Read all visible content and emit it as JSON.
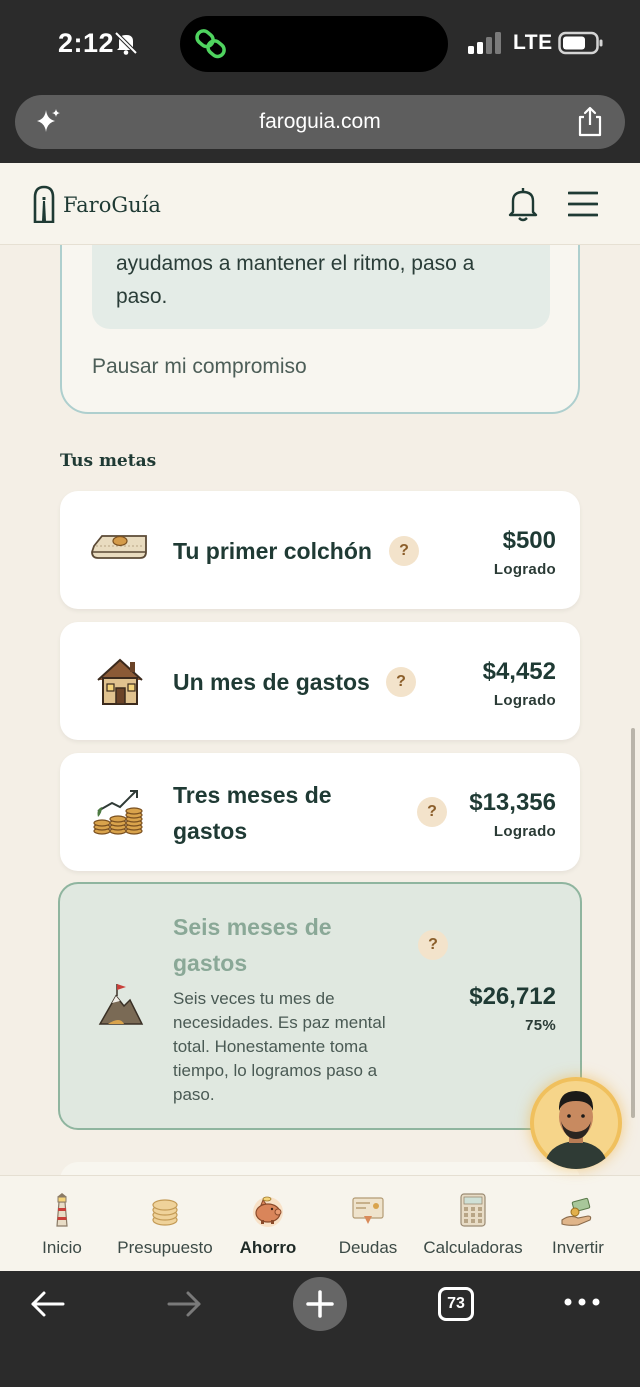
{
  "status_bar": {
    "time": "2:12",
    "network": "LTE"
  },
  "browser": {
    "url": "faroguia.com",
    "tab_count": "73"
  },
  "header": {
    "brand": "FaroGuía"
  },
  "commitment": {
    "note_text": "ayudamos a mantener el ritmo, paso a paso.",
    "pause_label": "Pausar mi compromiso"
  },
  "goals": {
    "title": "Tus metas",
    "items": [
      {
        "name": "Tu primer colchón",
        "amount": "$500",
        "status": "Logrado",
        "icon": "mattress-icon"
      },
      {
        "name": "Un mes de gastos",
        "amount": "$4,452",
        "status": "Logrado",
        "icon": "house-icon"
      },
      {
        "name": "Tres meses de gastos",
        "amount": "$13,356",
        "status": "Logrado",
        "icon": "coins-growth-icon"
      },
      {
        "name": "Seis meses de gastos",
        "amount": "$26,712",
        "status": "75%",
        "progress": 0.75,
        "icon": "mountain-flag-icon",
        "description": "Seis veces tu mes de necesidades. Es paz mental total. Honestamente toma tiempo, lo logramos paso a paso."
      }
    ],
    "help_glyph": "?"
  },
  "bottom_nav": [
    {
      "label": "Inicio",
      "icon": "lighthouse-icon"
    },
    {
      "label": "Presupuesto",
      "icon": "coins-stack-icon"
    },
    {
      "label": "Ahorro",
      "icon": "piggy-bank-icon",
      "active": true
    },
    {
      "label": "Deudas",
      "icon": "bill-icon"
    },
    {
      "label": "Calculadoras",
      "icon": "calculator-icon"
    },
    {
      "label": "Invertir",
      "icon": "money-hand-icon"
    }
  ],
  "colors": {
    "accent_teal": "#aecfce",
    "active_card_bg": "#e0e8e0",
    "active_card_border": "#8fb59f",
    "brand_dark": "#1f3a34"
  }
}
